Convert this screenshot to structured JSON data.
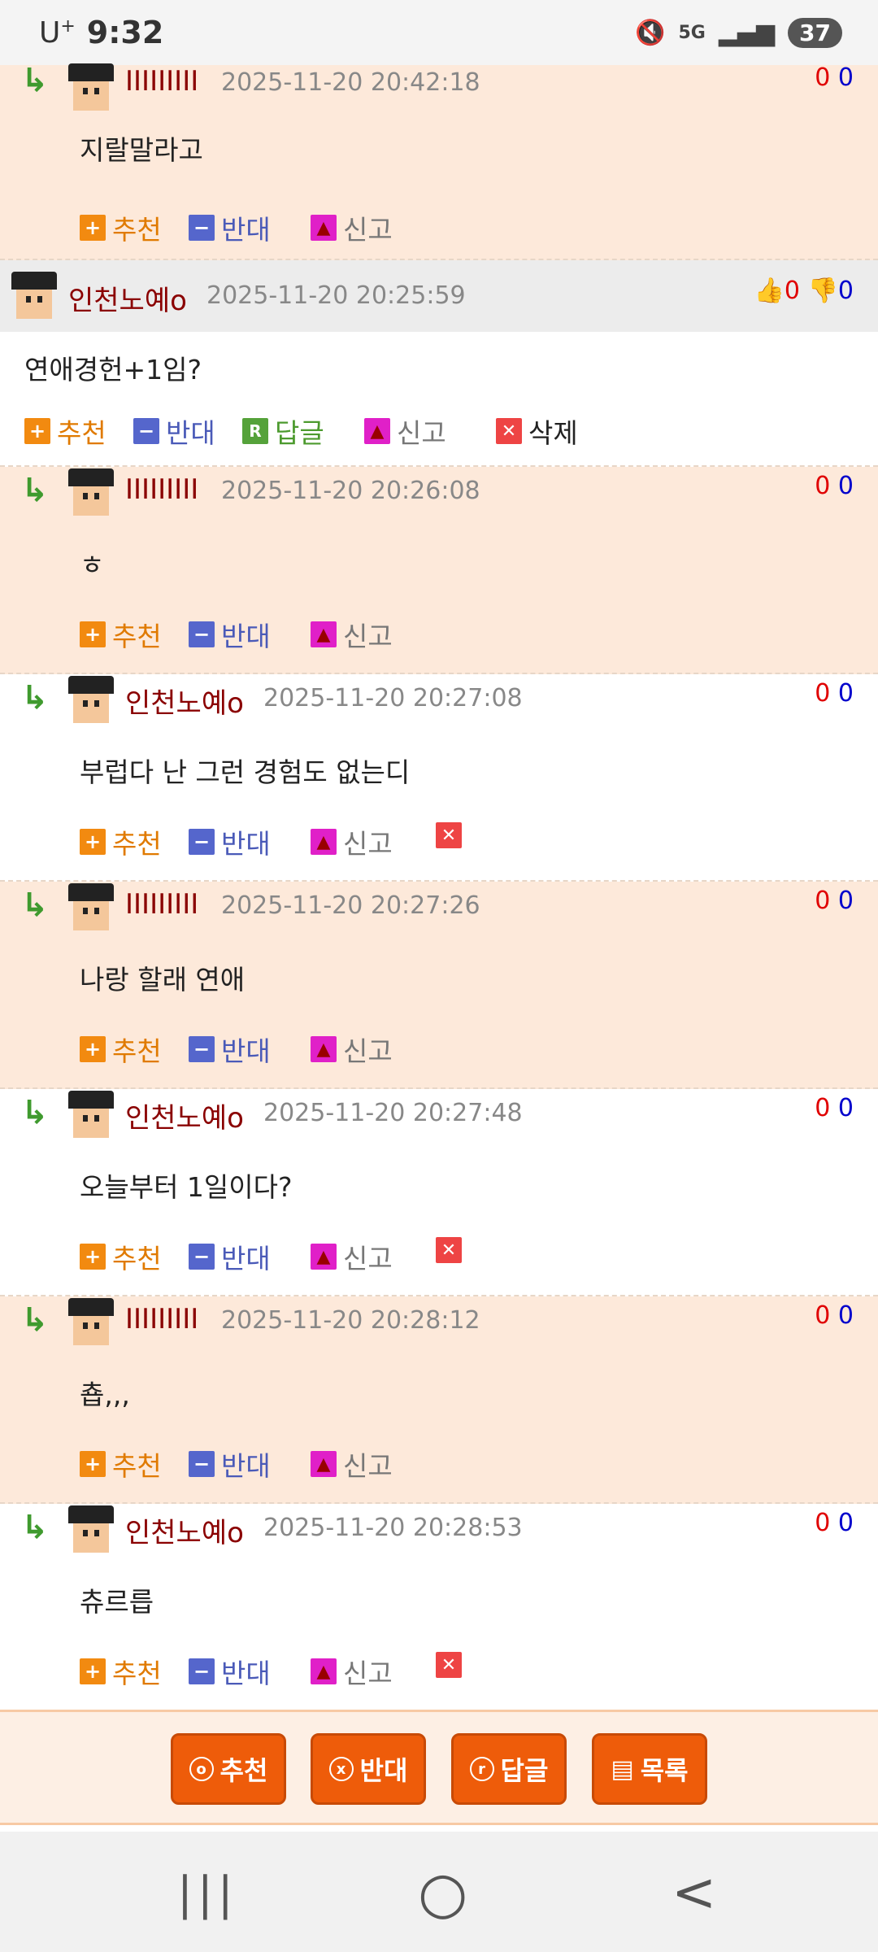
{
  "status_bar": {
    "carrier": "U",
    "carrier_sup": "+",
    "time": "9:32",
    "mute_icon": "🔇",
    "network": "5G",
    "signal": "▂▄▆",
    "battery": "37"
  },
  "action_labels": {
    "recommend": "추천",
    "oppose": "반대",
    "reply": "답글",
    "report": "신고",
    "delete": "삭제"
  },
  "main_comment": {
    "nickname": "인천노예o",
    "date": "2025-11-20 20:25:59",
    "up": "0",
    "down": "0",
    "text": "연애경헌+1임?"
  },
  "replies": [
    {
      "nickname": "IIIIIIIII",
      "date": "2025-11-20 20:42:18",
      "up": "0",
      "down": "0",
      "text": "지랄말라고"
    },
    {
      "nickname": "IIIIIIIII",
      "date": "2025-11-20 20:26:08",
      "up": "0",
      "down": "0",
      "text": "ㅎ"
    },
    {
      "nickname": "인천노예o",
      "date": "2025-11-20 20:27:08",
      "up": "0",
      "down": "0",
      "text": "부럽다 난 그런 경험도 없는디"
    },
    {
      "nickname": "IIIIIIIII",
      "date": "2025-11-20 20:27:26",
      "up": "0",
      "down": "0",
      "text": "나랑 할래 연애"
    },
    {
      "nickname": "인천노예o",
      "date": "2025-11-20 20:27:48",
      "up": "0",
      "down": "0",
      "text": "오늘부터 1일이다?"
    },
    {
      "nickname": "IIIIIIIII",
      "date": "2025-11-20 20:28:12",
      "up": "0",
      "down": "0",
      "text": "춉,,,"
    },
    {
      "nickname": "인천노예o",
      "date": "2025-11-20 20:28:53",
      "up": "0",
      "down": "0",
      "text": "츄르릅"
    }
  ],
  "bottom_buttons": {
    "recommend": "추천",
    "oppose": "반대",
    "reply": "답글",
    "list": "목록"
  },
  "navbar": {
    "recents": "|||",
    "home": "○",
    "back": "<"
  }
}
